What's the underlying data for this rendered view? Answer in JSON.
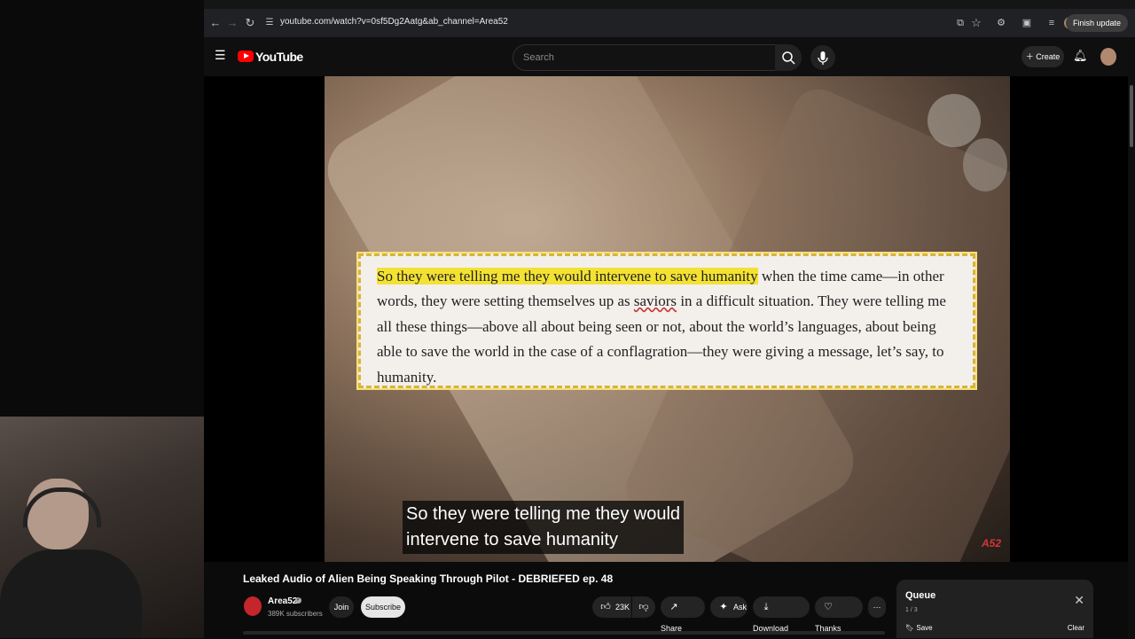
{
  "browser": {
    "url": "youtube.com/watch?v=0sf5Dg2Aatg&ab_channel=Area52",
    "finish_update_label": "Finish update"
  },
  "header": {
    "logo_text": "YouTube",
    "search_placeholder": "Search",
    "create_label": "Create"
  },
  "video": {
    "quote_highlighted": "So they were telling me they would intervene to save humanity",
    "quote_rest_1": " when the time came—in other words, they were setting themselves up as ",
    "quote_spell_word": "saviors",
    "quote_rest_2": " in a difficult situation. They were telling me all these things—above all about being seen or not, about the world’s languages, about being able to save the world in the case of a conflagration—they were giving a message, let’s say, to humanity.",
    "caption_line_1": "So they were telling me they would",
    "caption_line_2": "intervene to save humanity",
    "watermark": "A52",
    "title": "Leaked Audio of Alien Being Speaking Through Pilot - DEBRIEFED ep. 48"
  },
  "channel": {
    "avatar_text": "A52",
    "name": "Area52",
    "subscribers": "389K subscribers",
    "join_label": "Join",
    "subscribe_label": "Subscribe"
  },
  "actions": {
    "likes": "23K",
    "share": "Share",
    "ask": "Ask",
    "download": "Download",
    "thanks": "Thanks"
  },
  "queue": {
    "title": "Queue",
    "count": "1 / 3",
    "save": "Save",
    "clear": "Clear"
  }
}
